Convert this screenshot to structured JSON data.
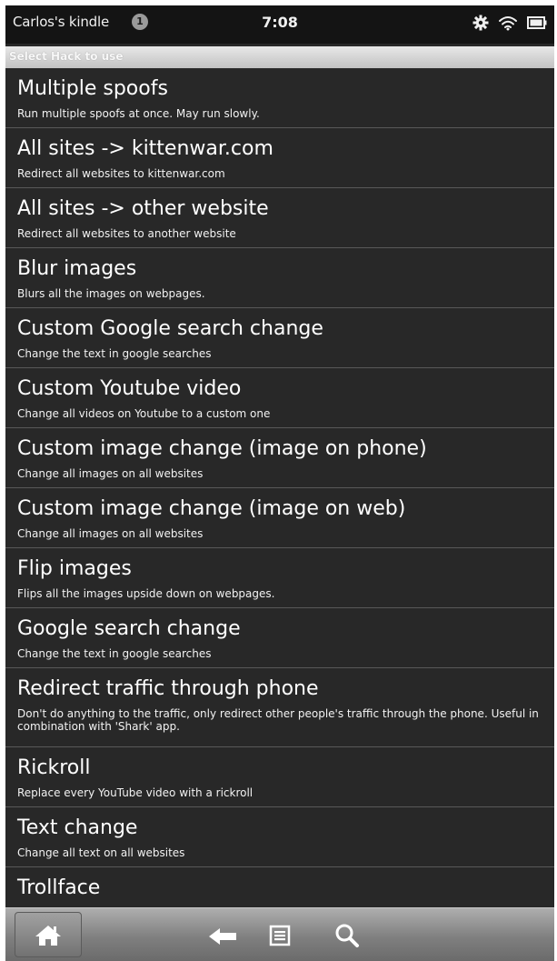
{
  "status": {
    "device_name": "Carlos's kindle",
    "notification_count": "1",
    "time": "7:08",
    "icons": [
      "settings-gear-icon",
      "wifi-icon",
      "battery-icon"
    ]
  },
  "header": {
    "title": "Select Hack to use"
  },
  "hacks": [
    {
      "title": "Multiple spoofs",
      "subtitle": "Run multiple spoofs at once. May run slowly."
    },
    {
      "title": "All sites -> kittenwar.com",
      "subtitle": "Redirect all websites to kittenwar.com"
    },
    {
      "title": "All sites -> other website",
      "subtitle": "Redirect all websites to another website"
    },
    {
      "title": "Blur images",
      "subtitle": "Blurs all the images on webpages."
    },
    {
      "title": "Custom Google search change",
      "subtitle": "Change the text in google searches"
    },
    {
      "title": "Custom Youtube video",
      "subtitle": "Change all videos on Youtube to a custom one"
    },
    {
      "title": "Custom image change (image on phone)",
      "subtitle": "Change all images on all websites"
    },
    {
      "title": "Custom image change (image on web)",
      "subtitle": "Change all images on all websites"
    },
    {
      "title": "Flip images",
      "subtitle": "Flips all the images upside down on webpages."
    },
    {
      "title": "Google search change",
      "subtitle": "Change the text in google searches"
    },
    {
      "title": "Redirect traffic through phone",
      "subtitle": "Don't do anything to the traffic, only redirect other people's traffic through the phone. Useful in combination with 'Shark' app."
    },
    {
      "title": "Rickroll",
      "subtitle": "Replace every YouTube video with a rickroll"
    },
    {
      "title": "Text change",
      "subtitle": "Change all text on all websites"
    },
    {
      "title": "Trollface",
      "subtitle": ""
    }
  ],
  "navbar": {
    "icons": [
      "home-icon",
      "back-arrow-icon",
      "menu-icon",
      "search-icon"
    ]
  }
}
